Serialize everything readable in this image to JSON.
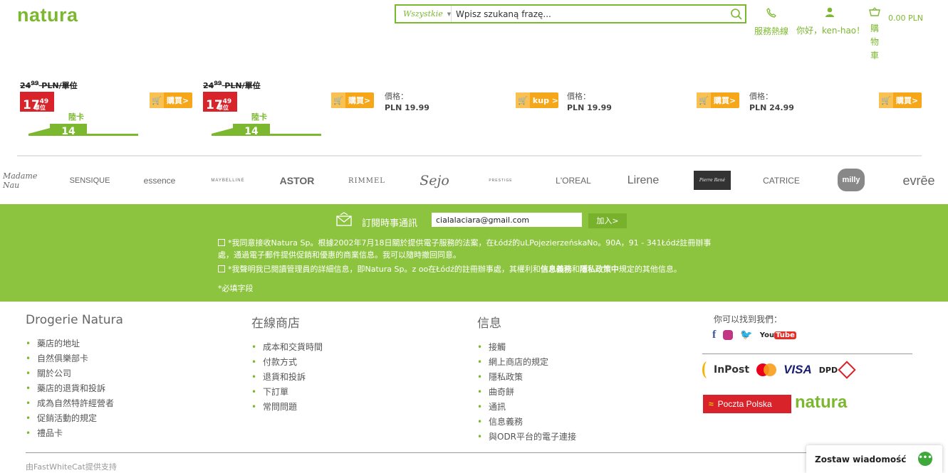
{
  "header": {
    "logo": "natura",
    "search_category": "Wszystkie",
    "search_placeholder": "Wpisz szukaną frazę...",
    "hotline_label": "服務熱線",
    "user_greeting": "你好，ken-hao！",
    "cart_label": "購物車",
    "cart_total": "0.00 PLN"
  },
  "products": [
    {
      "old_price_int": "24",
      "old_price_dec": "99",
      "old_price_suffix": "PLN/單位",
      "sale_int": "17",
      "sale_dec": "49",
      "sale_unit": "單位",
      "card_label": "陸卡",
      "card_value": "14",
      "buy_label": "購買>"
    },
    {
      "old_price_int": "24",
      "old_price_dec": "99",
      "old_price_suffix": "PLN/單位",
      "sale_int": "17",
      "sale_dec": "49",
      "sale_unit": "單位",
      "card_label": "陸卡",
      "card_value": "14",
      "buy_label": "購買>"
    },
    {
      "price_label": "價格：",
      "price_value": "PLN 19.99",
      "buy_label": "kup >"
    },
    {
      "price_label": "價格：",
      "price_value": "PLN 19.99",
      "buy_label": "購買>"
    },
    {
      "price_label": "價格：",
      "price_value": "PLN 24.99",
      "buy_label": "購買>"
    }
  ],
  "brands": [
    "Madame Nau",
    "SENSIQUE",
    "essence",
    "MAYBELLINE",
    "ASTOR",
    "RIMMEL",
    "Sejo",
    "PRESTIGE",
    "L'OREAL",
    "Lirene",
    "Pierre René",
    "CATRICE",
    "milly",
    "evrēe"
  ],
  "newsletter": {
    "title": "訂閱時事通訊",
    "email": "cialalaciara@gmail.com",
    "submit": "加入>",
    "consent1": "*我同意接收Natura Sp。根據2002年7月18日關於提供電子服務的法案，在Łódź的uLPojezierzeńskaNo。90A，91 - 341Łódź註冊辦事處，通過電子郵件提供促銷和優惠的商業信息。我可以隨時撤回同意。",
    "consent2_a": "*我聲明我已閱讀管理員的詳細信息，即Natura Sp。z oo在Łódź的註冊辦事處，其權利和",
    "consent2_b": "信息義務",
    "consent2_c": "和",
    "consent2_d": "隱私政策中",
    "consent2_e": "規定的其他信息。",
    "required": "*必填字段"
  },
  "footer": {
    "col1": {
      "title": "Drogerie Natura",
      "items": [
        "藥店的地址",
        "自然俱樂部卡",
        "關於公司",
        "藥店的退貨和投訴",
        "成為自然特許經營者",
        "促銷活動的規定",
        "禮品卡"
      ]
    },
    "col2": {
      "title": "在線商店",
      "items": [
        "成本和交貨時間",
        "付款方式",
        "退貨和投訴",
        "下訂單",
        "常問問題"
      ]
    },
    "col3": {
      "title": "信息",
      "items": [
        "接觸",
        "網上商店的規定",
        "隱私政策",
        "曲奇餅",
        "通訊",
        "信息義務",
        "與ODR平台的電子連接"
      ]
    },
    "find_us": "你可以找到我們：",
    "social": {
      "facebook": "f",
      "youtube_a": "You",
      "youtube_b": "Tube"
    },
    "payments": {
      "inpost": "InPost",
      "visa": "VISA",
      "dpd": "DPD",
      "poczta": "Poczta Polska",
      "natura": "natura"
    },
    "powered_by": "由FastWhiteCat提供支持"
  },
  "chat": {
    "label": "Zostaw wiadomość"
  },
  "colors": {
    "brand_green": "#7cb82f",
    "newsletter_bg": "#8cc43f",
    "sale_red": "#d8232a",
    "buy_orange": "#f6a719"
  }
}
